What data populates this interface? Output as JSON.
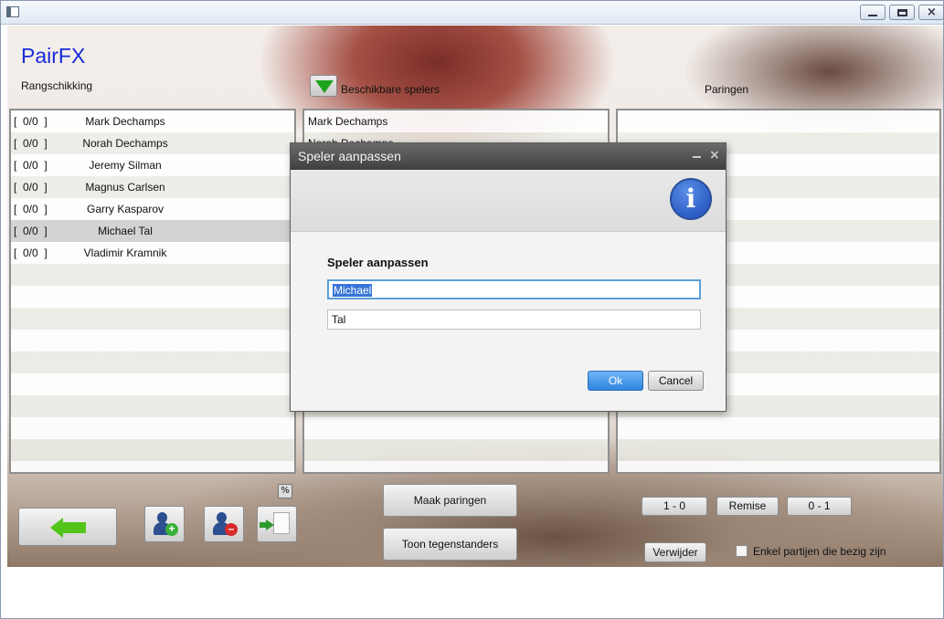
{
  "app": {
    "title": "PairFX"
  },
  "headers": {
    "ranking": "Rangschikking",
    "available": "Beschikbare spelers",
    "pairings": "Paringen"
  },
  "ranking": [
    {
      "score": "[  0/0  ]",
      "name": "Mark Dechamps",
      "selected": false
    },
    {
      "score": "[  0/0  ]",
      "name": "Norah Dechamps",
      "selected": false
    },
    {
      "score": "[  0/0  ]",
      "name": "Jeremy Silman",
      "selected": false
    },
    {
      "score": "[  0/0  ]",
      "name": "Magnus Carlsen",
      "selected": false
    },
    {
      "score": "[  0/0  ]",
      "name": "Garry Kasparov",
      "selected": false
    },
    {
      "score": "[  0/0  ]",
      "name": "Michael Tal",
      "selected": true
    },
    {
      "score": "[  0/0  ]",
      "name": "Vladimir Kramnik",
      "selected": false
    }
  ],
  "available_players": [
    "Mark Dechamps",
    "Norah Dechamps"
  ],
  "toolbar": {
    "percent_label": "%",
    "make_pairs": "Maak paringen",
    "show_opponents": "Toon tegenstanders",
    "result_white": "1 - 0",
    "result_draw": "Remise",
    "result_black": "0 - 1",
    "delete": "Verwijder",
    "active_only": "Enkel partijen die bezig zijn"
  },
  "dialog": {
    "title": "Speler aanpassen",
    "heading": "Speler aanpassen",
    "first_name": "Michael",
    "last_name": "Tal",
    "ok": "Ok",
    "cancel": "Cancel",
    "info_glyph": "i"
  }
}
